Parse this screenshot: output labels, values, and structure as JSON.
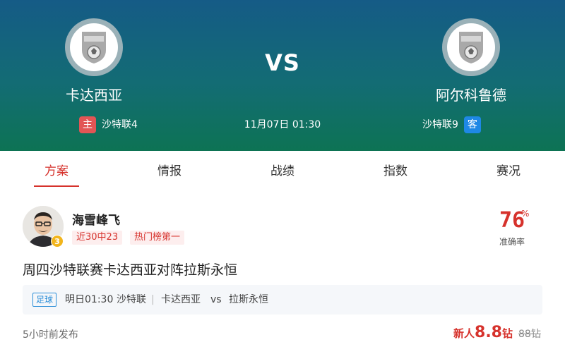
{
  "match": {
    "vs_label": "VS",
    "time": "11月07日 01:30",
    "home": {
      "name": "卡达西亚",
      "badge": "主",
      "league_rank": "沙特联4"
    },
    "away": {
      "name": "阿尔科鲁德",
      "badge": "客",
      "league_rank": "沙特联9"
    }
  },
  "tabs": [
    {
      "label": "方案",
      "active": true
    },
    {
      "label": "情报",
      "active": false
    },
    {
      "label": "战绩",
      "active": false
    },
    {
      "label": "指数",
      "active": false
    },
    {
      "label": "赛况",
      "active": false
    }
  ],
  "expert": {
    "name": "海雪峰飞",
    "rank": "3",
    "tags": [
      "近30中23",
      "热门榜第一"
    ],
    "accuracy_value": "76",
    "accuracy_unit": "%",
    "accuracy_label": "准确率"
  },
  "article": {
    "title": "周四沙特联赛卡达西亚对阵拉斯永恒",
    "match_card": {
      "sport": "足球",
      "time": "明日01:30",
      "league": "沙特联",
      "separator": "|",
      "home": "卡达西亚",
      "vs": "vs",
      "away": "拉斯永恒"
    },
    "published": "5小时前发布",
    "price": {
      "prefix": "新人",
      "value": "8.8",
      "unit": "钻",
      "original": "88钻"
    }
  },
  "colors": {
    "accent": "#d6322c",
    "header_top": "#155b86",
    "header_bottom": "#0d7354",
    "host_badge": "#e25555",
    "guest_badge": "#1e88e5"
  }
}
